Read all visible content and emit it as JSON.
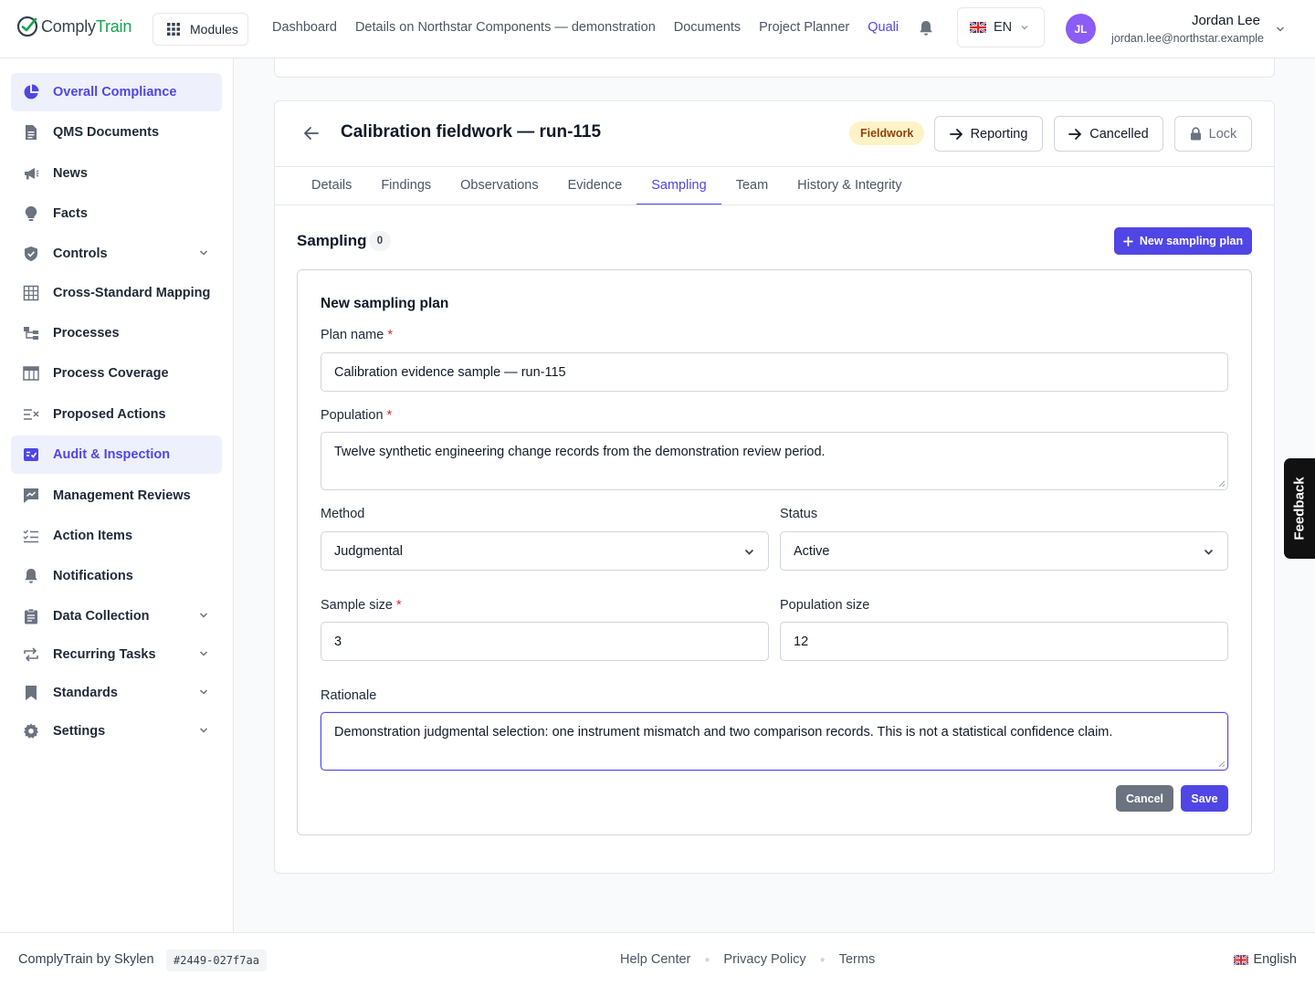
{
  "app": {
    "brand_part1": "Comply",
    "brand_part2": "Train",
    "brand_color": "#16a34a",
    "accent_color": "#4f46e5"
  },
  "topnav": {
    "modules_label": "Modules",
    "links": [
      "Dashboard",
      "Details on Northstar Components — demonstration",
      "Documents",
      "Project Planner",
      "Quali"
    ],
    "language": "EN",
    "user_initials": "JL",
    "user_name": "Jordan Lee",
    "user_email": "jordan.lee@northstar.example"
  },
  "sidebar": {
    "items": [
      {
        "label": "Overall Compliance",
        "icon": "pie-chart-icon"
      },
      {
        "label": "QMS Documents",
        "icon": "document-icon"
      },
      {
        "label": "News",
        "icon": "megaphone-icon"
      },
      {
        "label": "Facts",
        "icon": "lightbulb-icon"
      },
      {
        "label": "Controls",
        "icon": "shield-check-icon"
      },
      {
        "label": "Cross-Standard Mapping",
        "icon": "grid-icon"
      },
      {
        "label": "Processes",
        "icon": "process-icon"
      },
      {
        "label": "Process Coverage",
        "icon": "table-icon"
      },
      {
        "label": "Proposed Actions",
        "icon": "list-x-icon"
      },
      {
        "label": "Audit & Inspection",
        "icon": "audit-check-icon"
      },
      {
        "label": "Management Reviews",
        "icon": "chat-chart-icon"
      },
      {
        "label": "Action Items",
        "icon": "checklist-icon"
      },
      {
        "label": "Notifications",
        "icon": "bell-icon"
      },
      {
        "label": "Data Collection",
        "icon": "clipboard-icon"
      },
      {
        "label": "Recurring Tasks",
        "icon": "repeat-icon"
      },
      {
        "label": "Standards",
        "icon": "bookmark-icon"
      },
      {
        "label": "Settings",
        "icon": "gear-icon"
      }
    ]
  },
  "page": {
    "title": "Calibration fieldwork — run-115",
    "status_badge": "Fieldwork",
    "actions": {
      "reporting": "Reporting",
      "cancelled": "Cancelled",
      "lock": "Lock"
    },
    "tabs": [
      "Details",
      "Findings",
      "Observations",
      "Evidence",
      "Sampling",
      "Team",
      "History & Integrity"
    ],
    "active_tab": "Sampling"
  },
  "sampling": {
    "title": "Sampling",
    "count": "0",
    "new_button": "New sampling plan"
  },
  "form": {
    "title": "New sampling plan",
    "plan_name_label": "Plan name",
    "plan_name_value": "Calibration evidence sample — run-115",
    "population_label": "Population",
    "population_value": "Twelve synthetic engineering change records from the demonstration review period.",
    "method_label": "Method",
    "method_value": "Judgmental",
    "status_label": "Status",
    "status_value": "Active",
    "sample_size_label": "Sample size",
    "sample_size_value": "3",
    "population_size_label": "Population size",
    "population_size_value": "12",
    "rationale_label": "Rationale",
    "rationale_value": "Demonstration judgmental selection: one instrument mismatch and two comparison records. This is not a statistical confidence claim.",
    "cancel": "Cancel",
    "save": "Save"
  },
  "feedback": "Feedback",
  "footer": {
    "brand": "ComplyTrain by Skylen",
    "build_hash": "#2449-027f7aa",
    "links": [
      "Help Center",
      "Privacy Policy",
      "Terms"
    ],
    "language": "English"
  }
}
